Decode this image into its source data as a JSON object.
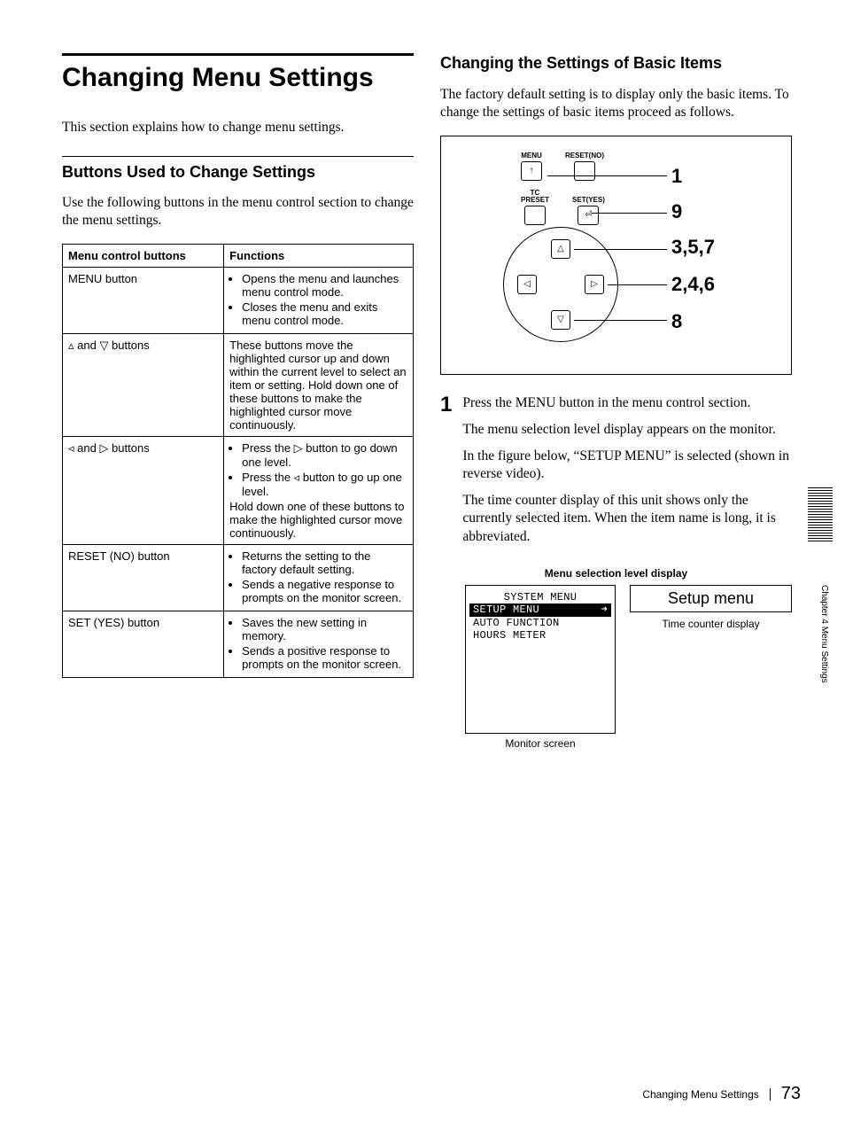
{
  "left": {
    "title": "Changing Menu Settings",
    "intro": "This section explains how to change menu settings.",
    "sub": "Buttons Used to Change Settings",
    "sub_intro": "Use the following buttons in the menu control section to change the menu settings.",
    "table": {
      "h1": "Menu control buttons",
      "h2": "Functions",
      "rows": [
        {
          "name": "MENU button",
          "bullets": [
            "Opens the menu and launches menu control mode.",
            "Closes the menu and exits menu control mode."
          ]
        },
        {
          "name": "▵ and ▽ buttons",
          "plain": "These buttons move the highlighted cursor up and down within the current level to select an item or setting. Hold down one of these buttons to make the highlighted cursor move continuously."
        },
        {
          "name": "◃ and ▷ buttons",
          "bullets": [
            "Press the ▷ button to go down one level.",
            "Press the ◃ button to go up one level."
          ],
          "trail": "Hold down one of these buttons to make the highlighted cursor move continuously."
        },
        {
          "name": "RESET (NO) button",
          "bullets": [
            "Returns the setting to the factory default setting.",
            "Sends a negative response to prompts on the monitor screen."
          ]
        },
        {
          "name": "SET (YES) button",
          "bullets": [
            "Saves the new setting in memory.",
            "Sends a positive response to prompts on the monitor screen."
          ]
        }
      ]
    }
  },
  "right": {
    "heading": "Changing the Settings of Basic Items",
    "intro": "The factory default setting is to display only the basic items. To change the settings of basic items proceed as follows.",
    "diagram": {
      "labels": {
        "menu": "MENU",
        "reset": "RESET(NO)",
        "tc": "TC\nPRESET",
        "set": "SET(YES)"
      },
      "glyph_up": "↑",
      "glyph_set": "⏎",
      "callouts": {
        "c1": "1",
        "c9": "9",
        "c357": "3,5,7",
        "c246": "2,4,6",
        "c8": "8"
      },
      "arrows": {
        "up": "△▴",
        "down": "▽▾",
        "left": "◁◂",
        "right": "▷▸"
      }
    },
    "step1_num": "1",
    "step1_lead": "Press the MENU button in the menu control section.",
    "step1_p1": "The menu selection level display appears on the monitor.",
    "step1_p2": "In the figure below, “SETUP MENU” is selected (shown in reverse video).",
    "step1_p3": "The time counter display of this unit shows only the currently selected item. When the item name is long, it is abbreviated.",
    "caption_top": "Menu selection level display",
    "monitor": {
      "l1": "SYSTEM MENU",
      "l2": "SETUP MENU",
      "l2_arrow": "➜",
      "l3": "AUTO FUNCTION",
      "l4": "HOURS METER",
      "caption": "Monitor screen"
    },
    "counter": {
      "text": "Setup menu",
      "label": "Time counter display"
    }
  },
  "side": "Chapter 4  Menu Settings",
  "footer": {
    "title": "Changing Menu Settings",
    "page": "73"
  }
}
